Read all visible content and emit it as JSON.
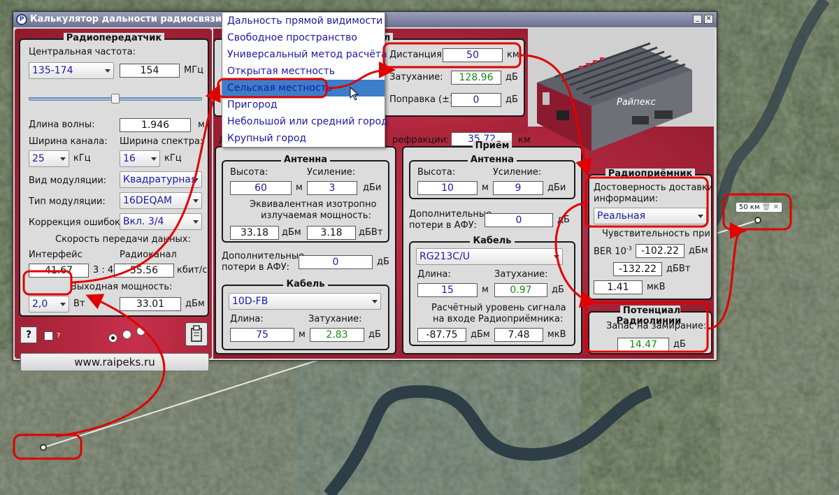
{
  "window": {
    "title": "Калькулятор дальности радиосвязи РА",
    "min": "_",
    "max": "□",
    "close": "✕"
  },
  "transmitter": {
    "title": "Радиопередатчик",
    "center_freq_label": "Центральная частота:",
    "band": "135-174",
    "freq": "154",
    "freq_unit": "МГц",
    "slider_fraction": 0.5,
    "wavelength_label": "Длина волны:",
    "wavelength": "1.946",
    "wavelength_unit": "м",
    "channel_width_label": "Ширина канала:",
    "channel_width": "25",
    "channel_width_unit": "кГц",
    "spectrum_width_label": "Ширина спектра:",
    "spectrum_width": "16",
    "spectrum_width_unit": "кГц",
    "modulation_kind_label": "Вид модуляции:",
    "modulation_kind": "Квадратурная",
    "modulation_type_label": "Тип модуляции:",
    "modulation_type": "16DEQAM",
    "fec_label": "Коррекция ошибок:",
    "fec": "Вкл. 3/4",
    "data_rate_label": "Скорость передачи данных:",
    "interface_label": "Интерфейс",
    "radio_channel_label": "Радиоканал",
    "interface_rate": "41.67",
    "ratio": "3 : 4",
    "radio_rate": "55.56",
    "rate_unit": "кбит/с",
    "output_power_label": "Выходная мощность:",
    "power_w": "2,0",
    "power_w_unit": "Вт",
    "power_dbm": "33.01",
    "power_dbm_unit": "дБм"
  },
  "bottom_left": {
    "help": "?",
    "help_q": "?",
    "site": "www.raipeks.ru"
  },
  "dropdown": {
    "items": [
      "Дальность прямой видимости",
      "Свободное пространство",
      "Универсальный метод расчёта",
      "Открытая местность",
      "Сельская местность",
      "Пригород",
      "Небольшой или средний город",
      "Крупный город"
    ],
    "selected_index": 4
  },
  "channel": {
    "title_tail": "нал",
    "distance_label": "Дистанция:",
    "distance": "50",
    "distance_unit": "км",
    "attenuation_label": "Затухание:",
    "attenuation": "128.96",
    "attenuation_unit": "дБ",
    "correction_label": "Поправка (±):",
    "correction": "0",
    "correction_unit": "дБ",
    "refraction_prefix": "Д",
    "refraction_label": "рефракции:",
    "refraction": "35.72",
    "refraction_unit": "км"
  },
  "tx_side": {
    "antenna_title": "Антенна",
    "height_label": "Высота:",
    "gain_label": "Усиление:",
    "height": "60",
    "height_unit": "м",
    "gain": "3",
    "gain_unit": "дБи",
    "eirp_label_1": "Эквивалентная изотропно",
    "eirp_label_2": "излучаемая мощность:",
    "eirp_dbm": "33.18",
    "eirp_dbm_unit": "дБм",
    "eirp_dbw": "3.18",
    "eirp_dbw_unit": "дБВт",
    "extra_loss_label_1": "Дополнительные",
    "extra_loss_label_2": "потери в АФУ:",
    "extra_loss": "0",
    "extra_loss_unit": "дБ",
    "cable_title": "Кабель",
    "cable_type": "10D-FB",
    "length_label": "Длина:",
    "cable_att_label": "Затухание:",
    "length": "75",
    "length_unit": "м",
    "cable_att": "2.83",
    "cable_att_unit": "дБ"
  },
  "rx_side": {
    "title": "Приём",
    "antenna_title": "Антенна",
    "height_label": "Высота:",
    "gain_label": "Усиление:",
    "height": "10",
    "height_unit": "м",
    "gain": "9",
    "gain_unit": "дБи",
    "extra_loss_label_1": "Дополнительные",
    "extra_loss_label_2": "потери в АФУ:",
    "extra_loss": "0",
    "extra_loss_unit": "дБ",
    "cable_title": "Кабель",
    "cable_type": "RG213C/U",
    "length_label": "Длина:",
    "cable_att_label": "Затухание:",
    "length": "15",
    "length_unit": "м",
    "cable_att": "0.97",
    "cable_att_unit": "дБ",
    "level_label_1": "Расчётный уровень сигнала",
    "level_label_2": "на входе Радиоприёмника:",
    "level_dbm": "-87.75",
    "level_dbm_unit": "дБм",
    "level_uv": "7.48",
    "level_uv_unit": "мкВ"
  },
  "receiver": {
    "title": "Радиоприёмник",
    "reliability_label_1": "Достоверность доставки",
    "reliability_label_2": "информации:",
    "reliability": "Реальная",
    "sensitivity_label_1": "Чувствительность при",
    "sensitivity_label_2": "BER 10",
    "sensitivity_exp": "-3",
    "sens_dbm": "-102.22",
    "sens_dbm_unit": "дБм",
    "sens_dbw": "-132.22",
    "sens_dbw_unit": "дБВт",
    "sens_uv": "1.41",
    "sens_uv_unit": "мкВ"
  },
  "potential": {
    "title": "Потенциал Радиолинии",
    "margin_label": "Запас на замирание:",
    "margin": "14.47",
    "margin_unit": "дБ"
  },
  "photo": {
    "brand": "Райпекс"
  },
  "map": {
    "pin_label": "50 км"
  },
  "colors": {
    "annotation": "#e00000",
    "crimson": "#b0233a",
    "input_text": "#1a1aa8",
    "ok_text": "#138a13"
  }
}
